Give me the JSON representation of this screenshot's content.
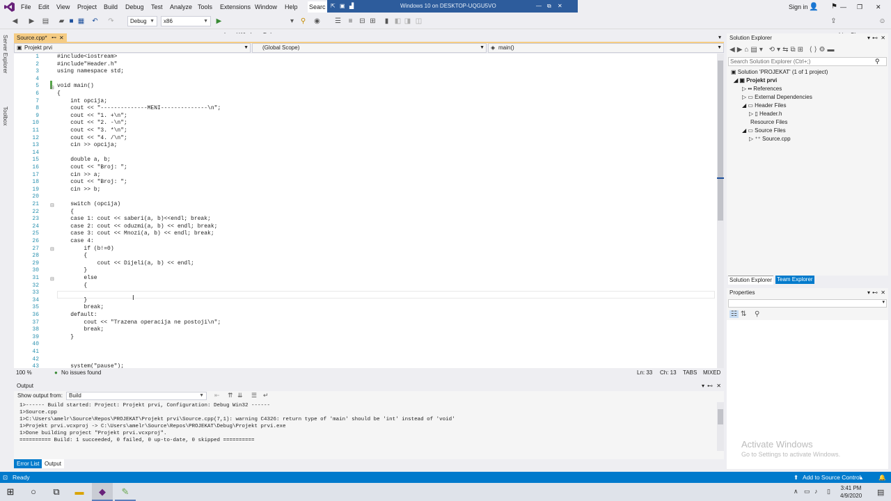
{
  "menu": {
    "items": [
      "File",
      "Edit",
      "View",
      "Project",
      "Build",
      "Debug",
      "Test",
      "Analyze",
      "Tools",
      "Extensions",
      "Window",
      "Help"
    ],
    "search": "Searc",
    "sign_in": "Sign in",
    "live_share": "Live Share"
  },
  "remote": {
    "title": "Windows 10 on DESKTOP-UQGU5VO"
  },
  "toolbar": {
    "config": "Debug",
    "platform": "x86",
    "debugger": "Local Windows Debugger"
  },
  "side_tabs": [
    "Server Explorer",
    "Toolbox"
  ],
  "doc_tab": {
    "name": "Source.cpp*"
  },
  "nav": {
    "project": "Projekt prvi",
    "scope": "(Global Scope)",
    "member": "main()"
  },
  "code_lines": [
    {
      "n": "1",
      "t": "#include<iostream>"
    },
    {
      "n": "2",
      "t": "#include\"Header.h\""
    },
    {
      "n": "3",
      "t": "using namespace std;"
    },
    {
      "n": "4",
      "t": ""
    },
    {
      "n": "5",
      "t": "void main()"
    },
    {
      "n": "6",
      "t": "{"
    },
    {
      "n": "7",
      "t": "    int opcija;"
    },
    {
      "n": "8",
      "t": "    cout << \"--------------MENI--------------\\n\";"
    },
    {
      "n": "9",
      "t": "    cout << \"1. +\\n\";"
    },
    {
      "n": "10",
      "t": "    cout << \"2. -\\n\";"
    },
    {
      "n": "11",
      "t": "    cout << \"3. *\\n\";"
    },
    {
      "n": "12",
      "t": "    cout << \"4. /\\n\";"
    },
    {
      "n": "13",
      "t": "    cin >> opcija;"
    },
    {
      "n": "14",
      "t": ""
    },
    {
      "n": "15",
      "t": "    double a, b;"
    },
    {
      "n": "16",
      "t": "    cout << \"Broj: \";"
    },
    {
      "n": "17",
      "t": "    cin >> a;"
    },
    {
      "n": "18",
      "t": "    cout << \"Broj: \";"
    },
    {
      "n": "19",
      "t": "    cin >> b;"
    },
    {
      "n": "20",
      "t": ""
    },
    {
      "n": "21",
      "t": "    switch (opcija)"
    },
    {
      "n": "22",
      "t": "    {"
    },
    {
      "n": "23",
      "t": "    case 1: cout << saberi(a, b)<<endl; break;"
    },
    {
      "n": "24",
      "t": "    case 2: cout << oduzmi(a, b) << endl; break;"
    },
    {
      "n": "25",
      "t": "    case 3: cout << Mnozi(a, b) << endl; break;"
    },
    {
      "n": "26",
      "t": "    case 4:"
    },
    {
      "n": "27",
      "t": "        if (b!=0)"
    },
    {
      "n": "28",
      "t": "        {"
    },
    {
      "n": "29",
      "t": "            cout << Dijeli(a, b) << endl;"
    },
    {
      "n": "30",
      "t": "        }"
    },
    {
      "n": "31",
      "t": "        else"
    },
    {
      "n": "32",
      "t": "        {"
    },
    {
      "n": "33",
      "t": ""
    },
    {
      "n": "34",
      "t": "        }"
    },
    {
      "n": "35",
      "t": "        break;"
    },
    {
      "n": "36",
      "t": "    default:"
    },
    {
      "n": "37",
      "t": "        cout << \"Trazena operacija ne postoji\\n\";"
    },
    {
      "n": "38",
      "t": "        break;"
    },
    {
      "n": "39",
      "t": "    }"
    },
    {
      "n": "40",
      "t": ""
    },
    {
      "n": "41",
      "t": ""
    },
    {
      "n": "42",
      "t": ""
    },
    {
      "n": "43",
      "t": "    system(\"pause\");"
    }
  ],
  "editor_status": {
    "zoom": "100 %",
    "issues": "No issues found",
    "ln": "Ln: 33",
    "ch": "Ch: 13",
    "tabs": "TABS",
    "eol": "MIXED"
  },
  "solution_explorer": {
    "title": "Solution Explorer",
    "search_placeholder": "Search Solution Explorer (Ctrl+;)",
    "items": [
      "Solution 'PROJEKAT' (1 of 1 project)",
      "Projekt prvi",
      "References",
      "External Dependencies",
      "Header Files",
      "Header.h",
      "Resource Files",
      "Source Files",
      "Source.cpp"
    ],
    "tabs": [
      "Solution Explorer",
      "Team Explorer"
    ]
  },
  "properties": {
    "title": "Properties"
  },
  "output": {
    "title": "Output",
    "show_from": "Show output from:",
    "source": "Build",
    "lines": [
      "1>------ Build started: Project: Projekt prvi, Configuration: Debug Win32 ------",
      "1>Source.cpp",
      "1>C:\\Users\\amelr\\Source\\Repos\\PROJEKAT\\Projekt prvi\\Source.cpp(7,1): warning C4326: return type of 'main' should be 'int' instead of 'void'",
      "1>Projekt prvi.vcxproj -> C:\\Users\\amelr\\Source\\Repos\\PROJEKAT\\Debug\\Projekt prvi.exe",
      "1>Done building project \"Projekt prvi.vcxproj\".",
      "========== Build: 1 succeeded, 0 failed, 0 up-to-date, 0 skipped =========="
    ],
    "tabs": [
      "Error List",
      "Output"
    ]
  },
  "watermark": {
    "title": "Activate Windows",
    "sub": "Go to Settings to activate Windows."
  },
  "statusbar": {
    "ready": "Ready",
    "source_control": "Add to Source Control"
  },
  "taskbar": {
    "time": "3:41 PM",
    "date": "4/9/2020"
  }
}
